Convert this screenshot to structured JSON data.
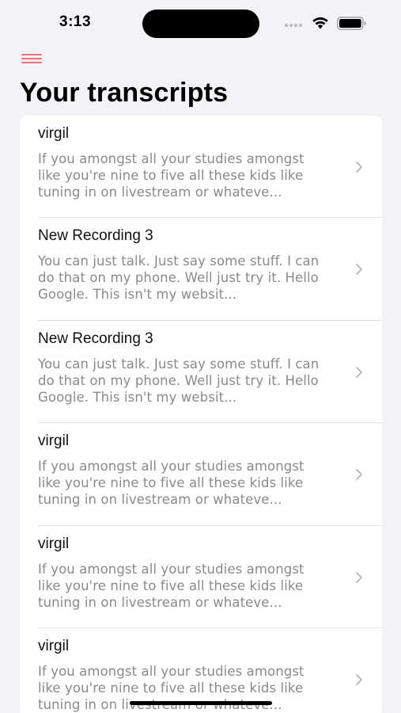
{
  "status_bar": {
    "time": "3:13",
    "icons": [
      "cellular-dots-icon",
      "wifi-icon",
      "battery-icon"
    ]
  },
  "header": {
    "menu_icon": "hamburger-menu-icon",
    "title": "Your transcripts"
  },
  "colors": {
    "background": "#f2f2f7",
    "accent": "#e8737b",
    "preview_text": "#8a8a8e"
  },
  "transcripts": [
    {
      "title": "virgil",
      "preview": "If you amongst all your studies amongst like you're nine to five all these kids like tuning in on livestream or whateve..."
    },
    {
      "title": "New Recording 3",
      "preview": "You can just talk. Just say some stuff. I can do that on my phone. Well just try it. Hello Google. This isn't my websit..."
    },
    {
      "title": "New Recording 3",
      "preview": "You can just talk. Just say some stuff. I can do that on my phone. Well just try it. Hello Google. This isn't my websit..."
    },
    {
      "title": "virgil",
      "preview": "If you amongst all your studies amongst like you're nine to five all these kids like tuning in on livestream or whateve..."
    },
    {
      "title": "virgil",
      "preview": "If you amongst all your studies amongst like you're nine to five all these kids like tuning in on livestream or whateve..."
    },
    {
      "title": "virgil",
      "preview": "If you amongst all your studies amongst like you're nine to five all these kids like tuning in on livestream or whateve..."
    }
  ]
}
